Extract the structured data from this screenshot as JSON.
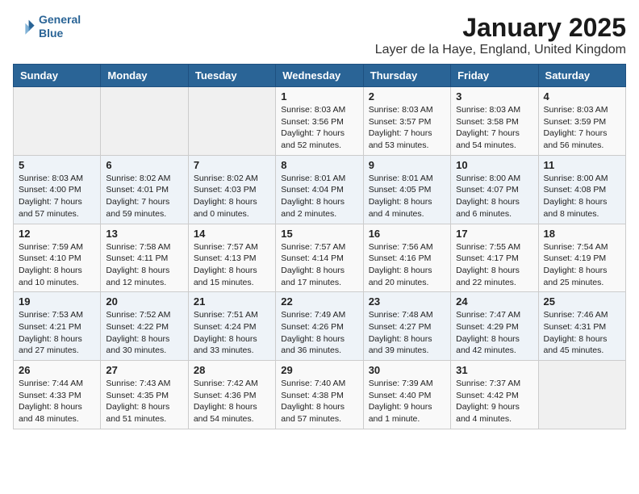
{
  "header": {
    "logo_line1": "General",
    "logo_line2": "Blue",
    "title": "January 2025",
    "subtitle": "Layer de la Haye, England, United Kingdom"
  },
  "days_of_week": [
    "Sunday",
    "Monday",
    "Tuesday",
    "Wednesday",
    "Thursday",
    "Friday",
    "Saturday"
  ],
  "weeks": [
    [
      {
        "day": "",
        "info": ""
      },
      {
        "day": "",
        "info": ""
      },
      {
        "day": "",
        "info": ""
      },
      {
        "day": "1",
        "info": "Sunrise: 8:03 AM\nSunset: 3:56 PM\nDaylight: 7 hours and 52 minutes."
      },
      {
        "day": "2",
        "info": "Sunrise: 8:03 AM\nSunset: 3:57 PM\nDaylight: 7 hours and 53 minutes."
      },
      {
        "day": "3",
        "info": "Sunrise: 8:03 AM\nSunset: 3:58 PM\nDaylight: 7 hours and 54 minutes."
      },
      {
        "day": "4",
        "info": "Sunrise: 8:03 AM\nSunset: 3:59 PM\nDaylight: 7 hours and 56 minutes."
      }
    ],
    [
      {
        "day": "5",
        "info": "Sunrise: 8:03 AM\nSunset: 4:00 PM\nDaylight: 7 hours and 57 minutes."
      },
      {
        "day": "6",
        "info": "Sunrise: 8:02 AM\nSunset: 4:01 PM\nDaylight: 7 hours and 59 minutes."
      },
      {
        "day": "7",
        "info": "Sunrise: 8:02 AM\nSunset: 4:03 PM\nDaylight: 8 hours and 0 minutes."
      },
      {
        "day": "8",
        "info": "Sunrise: 8:01 AM\nSunset: 4:04 PM\nDaylight: 8 hours and 2 minutes."
      },
      {
        "day": "9",
        "info": "Sunrise: 8:01 AM\nSunset: 4:05 PM\nDaylight: 8 hours and 4 minutes."
      },
      {
        "day": "10",
        "info": "Sunrise: 8:00 AM\nSunset: 4:07 PM\nDaylight: 8 hours and 6 minutes."
      },
      {
        "day": "11",
        "info": "Sunrise: 8:00 AM\nSunset: 4:08 PM\nDaylight: 8 hours and 8 minutes."
      }
    ],
    [
      {
        "day": "12",
        "info": "Sunrise: 7:59 AM\nSunset: 4:10 PM\nDaylight: 8 hours and 10 minutes."
      },
      {
        "day": "13",
        "info": "Sunrise: 7:58 AM\nSunset: 4:11 PM\nDaylight: 8 hours and 12 minutes."
      },
      {
        "day": "14",
        "info": "Sunrise: 7:57 AM\nSunset: 4:13 PM\nDaylight: 8 hours and 15 minutes."
      },
      {
        "day": "15",
        "info": "Sunrise: 7:57 AM\nSunset: 4:14 PM\nDaylight: 8 hours and 17 minutes."
      },
      {
        "day": "16",
        "info": "Sunrise: 7:56 AM\nSunset: 4:16 PM\nDaylight: 8 hours and 20 minutes."
      },
      {
        "day": "17",
        "info": "Sunrise: 7:55 AM\nSunset: 4:17 PM\nDaylight: 8 hours and 22 minutes."
      },
      {
        "day": "18",
        "info": "Sunrise: 7:54 AM\nSunset: 4:19 PM\nDaylight: 8 hours and 25 minutes."
      }
    ],
    [
      {
        "day": "19",
        "info": "Sunrise: 7:53 AM\nSunset: 4:21 PM\nDaylight: 8 hours and 27 minutes."
      },
      {
        "day": "20",
        "info": "Sunrise: 7:52 AM\nSunset: 4:22 PM\nDaylight: 8 hours and 30 minutes."
      },
      {
        "day": "21",
        "info": "Sunrise: 7:51 AM\nSunset: 4:24 PM\nDaylight: 8 hours and 33 minutes."
      },
      {
        "day": "22",
        "info": "Sunrise: 7:49 AM\nSunset: 4:26 PM\nDaylight: 8 hours and 36 minutes."
      },
      {
        "day": "23",
        "info": "Sunrise: 7:48 AM\nSunset: 4:27 PM\nDaylight: 8 hours and 39 minutes."
      },
      {
        "day": "24",
        "info": "Sunrise: 7:47 AM\nSunset: 4:29 PM\nDaylight: 8 hours and 42 minutes."
      },
      {
        "day": "25",
        "info": "Sunrise: 7:46 AM\nSunset: 4:31 PM\nDaylight: 8 hours and 45 minutes."
      }
    ],
    [
      {
        "day": "26",
        "info": "Sunrise: 7:44 AM\nSunset: 4:33 PM\nDaylight: 8 hours and 48 minutes."
      },
      {
        "day": "27",
        "info": "Sunrise: 7:43 AM\nSunset: 4:35 PM\nDaylight: 8 hours and 51 minutes."
      },
      {
        "day": "28",
        "info": "Sunrise: 7:42 AM\nSunset: 4:36 PM\nDaylight: 8 hours and 54 minutes."
      },
      {
        "day": "29",
        "info": "Sunrise: 7:40 AM\nSunset: 4:38 PM\nDaylight: 8 hours and 57 minutes."
      },
      {
        "day": "30",
        "info": "Sunrise: 7:39 AM\nSunset: 4:40 PM\nDaylight: 9 hours and 1 minute."
      },
      {
        "day": "31",
        "info": "Sunrise: 7:37 AM\nSunset: 4:42 PM\nDaylight: 9 hours and 4 minutes."
      },
      {
        "day": "",
        "info": ""
      }
    ]
  ]
}
